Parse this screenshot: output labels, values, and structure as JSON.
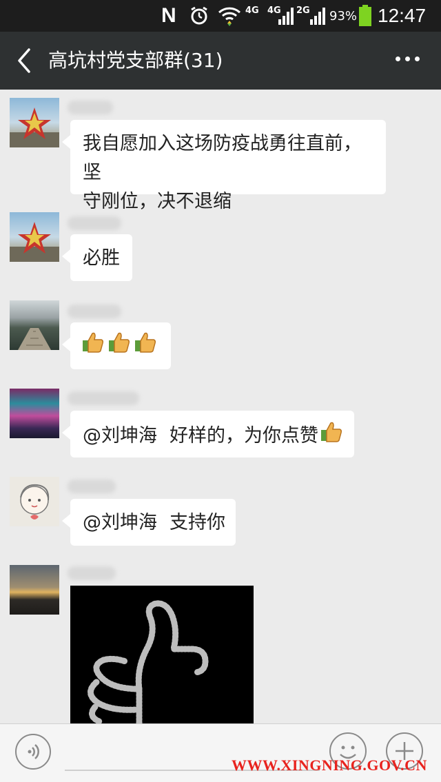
{
  "status_bar": {
    "network_letter": "N",
    "net1": "4G",
    "net2": "4G",
    "net3": "2G",
    "battery": "93%",
    "time": "12:47"
  },
  "nav": {
    "title": "高坑村党支部群(31)"
  },
  "messages": [
    {
      "text_line1": "我自愿加入这场防疫战勇往直前，坚",
      "text_line2": "守刚位，决不退缩"
    },
    {
      "text": "必胜"
    },
    {
      "emoji": [
        "thumbs-up",
        "thumbs-up",
        "thumbs-up"
      ]
    },
    {
      "mention": "@刘坤海",
      "text": "好样的，为你点赞"
    },
    {
      "mention": "@刘坤海",
      "text": "支持你"
    },
    {
      "type": "image",
      "image_desc": "thumbs-up-light-sculpture"
    }
  ],
  "watermark": "WWW.XINGNING.GOV.CN",
  "colors": {
    "status_bar": "#1d1d1d",
    "nav_bar": "#2e3132",
    "background": "#ebebeb",
    "bubble": "#ffffff",
    "watermark": "#e8231e"
  }
}
